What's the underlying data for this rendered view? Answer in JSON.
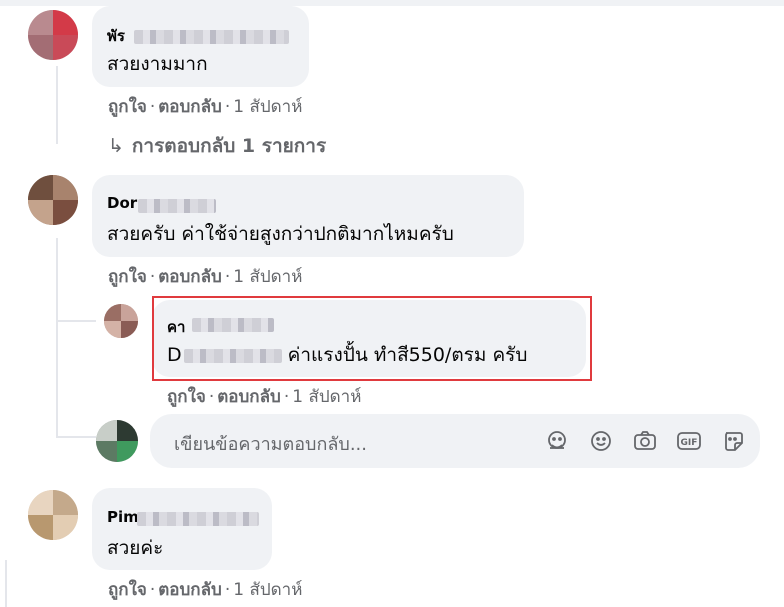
{
  "comments": [
    {
      "name": "พัร",
      "text": "สวยงามมาก",
      "actions": {
        "like": "ถูกใจ",
        "reply": "ตอบกลับ",
        "time": "1 สัปดาห์"
      },
      "replies_link": "การตอบกลับ 1 รายการ"
    },
    {
      "name": "Dor",
      "text": "สวยครับ ค่าใช้จ่ายสูงกว่าปกติมากไหมครับ",
      "actions": {
        "like": "ถูกใจ",
        "reply": "ตอบกลับ",
        "time": "1 สัปดาห์"
      },
      "reply": {
        "name": "คา",
        "mention": "D",
        "text": " ค่าแรงปั้น ทำสี550/ตรม ครับ",
        "actions": {
          "like": "ถูกใจ",
          "reply": "ตอบกลับ",
          "time": "1 สัปดาห์"
        }
      }
    },
    {
      "name": "Pim",
      "text": "สวยค่ะ",
      "actions": {
        "like": "ถูกใจ",
        "reply": "ตอบกลับ",
        "time": "1 สัปดาห์"
      }
    }
  ],
  "reply_input": {
    "placeholder": "เขียนข้อความตอบกลับ...",
    "icons": [
      "sticker-face-icon",
      "emoji-icon",
      "camera-icon",
      "gif-icon",
      "sticker-icon"
    ]
  },
  "colors": {
    "bubble": "#f0f2f5",
    "secondary_text": "#65676b",
    "highlight": "#e03a3e"
  }
}
